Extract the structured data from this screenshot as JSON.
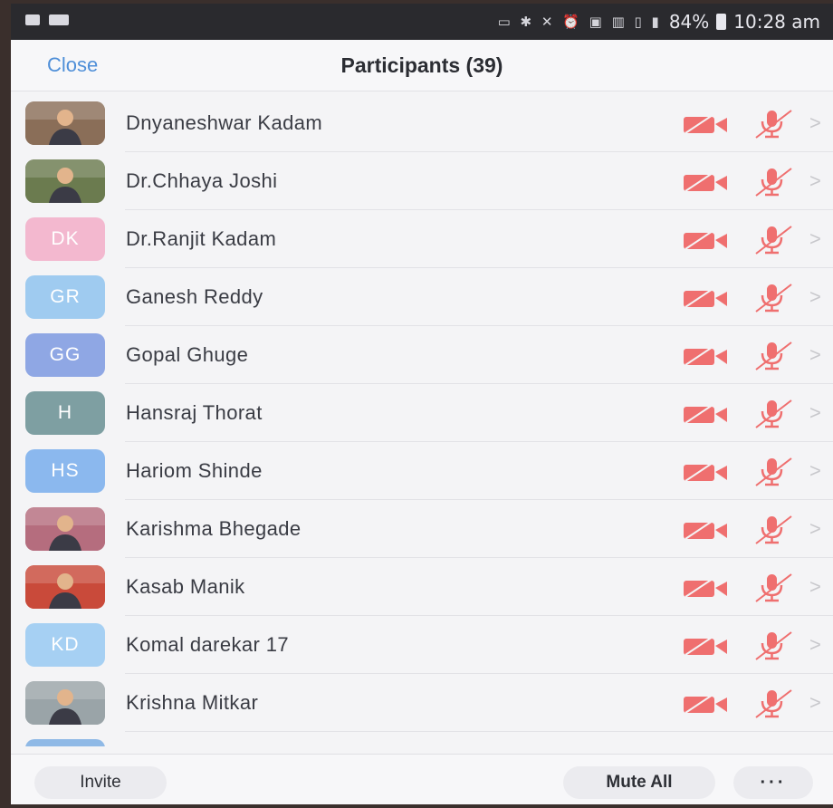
{
  "status_bar": {
    "battery": "84%",
    "time": "10:28 am",
    "icons": [
      "cast-icon",
      "bluetooth-icon",
      "mute-icon",
      "alarm-icon",
      "volte-icon",
      "signal-icon",
      "signal-icon"
    ]
  },
  "header": {
    "close_label": "Close",
    "title": "Participants (39)"
  },
  "participants": [
    {
      "name": "Dnyaneshwar Kadam",
      "avatar_type": "photo",
      "initials": "",
      "avatar_color": "#8a6e58"
    },
    {
      "name": "Dr.Chhaya Joshi",
      "avatar_type": "photo",
      "initials": "",
      "avatar_color": "#6b7b4f"
    },
    {
      "name": "Dr.Ranjit Kadam",
      "avatar_type": "initials",
      "initials": "DK",
      "avatar_color": "#f3b8cf"
    },
    {
      "name": "Ganesh Reddy",
      "avatar_type": "initials",
      "initials": "GR",
      "avatar_color": "#9fcbf0"
    },
    {
      "name": "Gopal Ghuge",
      "avatar_type": "initials",
      "initials": "GG",
      "avatar_color": "#8fa7e4"
    },
    {
      "name": "Hansraj Thorat",
      "avatar_type": "initials",
      "initials": "H",
      "avatar_color": "#7e9fa2"
    },
    {
      "name": "Hariom Shinde",
      "avatar_type": "initials",
      "initials": "HS",
      "avatar_color": "#8bb8ee"
    },
    {
      "name": "Karishma Bhegade",
      "avatar_type": "photo",
      "initials": "",
      "avatar_color": "#b56d7e"
    },
    {
      "name": "Kasab Manik",
      "avatar_type": "photo",
      "initials": "",
      "avatar_color": "#c94a3a"
    },
    {
      "name": "Komal darekar 17",
      "avatar_type": "initials",
      "initials": "KD",
      "avatar_color": "#a6d0f3"
    },
    {
      "name": "Krishna Mitkar",
      "avatar_type": "photo",
      "initials": "",
      "avatar_color": "#9aa4a8"
    }
  ],
  "row_icons": {
    "video": "video-off-icon",
    "audio": "mic-muted-icon",
    "chevron": "chevron-right-icon",
    "muted_color": "#ef6f6f"
  },
  "bottom_bar": {
    "invite_label": "Invite",
    "mute_all_label": "Mute All",
    "more_label": "···"
  },
  "colors": {
    "accent": "#4f8fd8",
    "status_bar_bg": "#2a2a2e",
    "background": "#f4f4f6"
  }
}
